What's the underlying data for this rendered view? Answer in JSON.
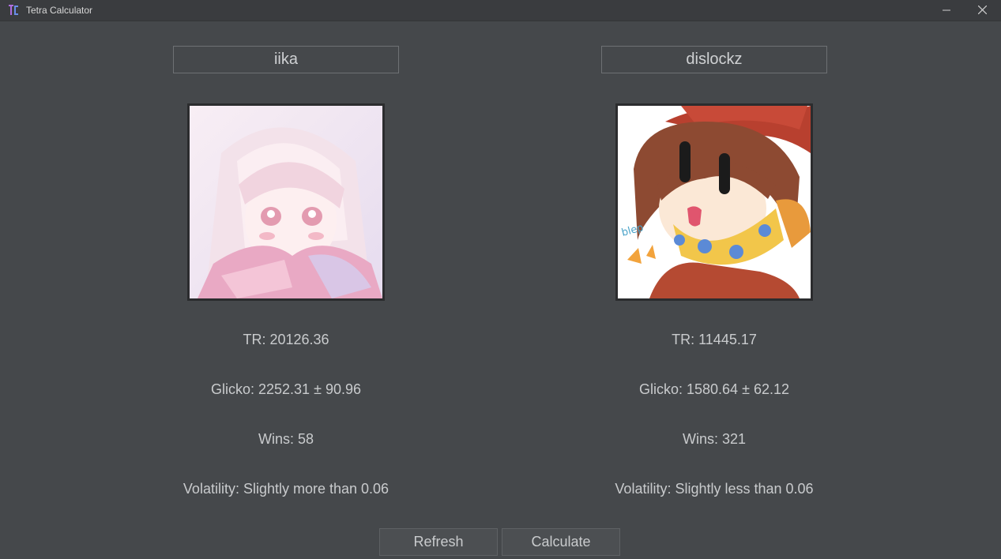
{
  "window": {
    "title": "Tetra Calculator",
    "app_icon": "tc-logo-icon",
    "controls": [
      "minimize-icon",
      "close-icon"
    ]
  },
  "left_player": {
    "username": "iika",
    "avatar": "anime-girl-avatar",
    "tr": "TR: 20126.36",
    "glicko": "Glicko: 2252.31 ± 90.96",
    "wins": "Wins: 58",
    "volatility": "Volatility: Slightly more than 0.06"
  },
  "right_player": {
    "username": "dislockz",
    "avatar": "cartoon-character-avatar",
    "avatar_caption": "blep",
    "tr": "TR: 11445.17",
    "glicko": "Glicko: 1580.64 ± 62.12",
    "wins": "Wins: 321",
    "volatility": "Volatility: Slightly less than 0.06"
  },
  "buttons": {
    "refresh": "Refresh",
    "calculate": "Calculate"
  },
  "colors": {
    "background": "#45484b",
    "titlebar": "#3a3c3f",
    "text": "#c9cbcd",
    "accent_icon": "#9b59d0"
  }
}
